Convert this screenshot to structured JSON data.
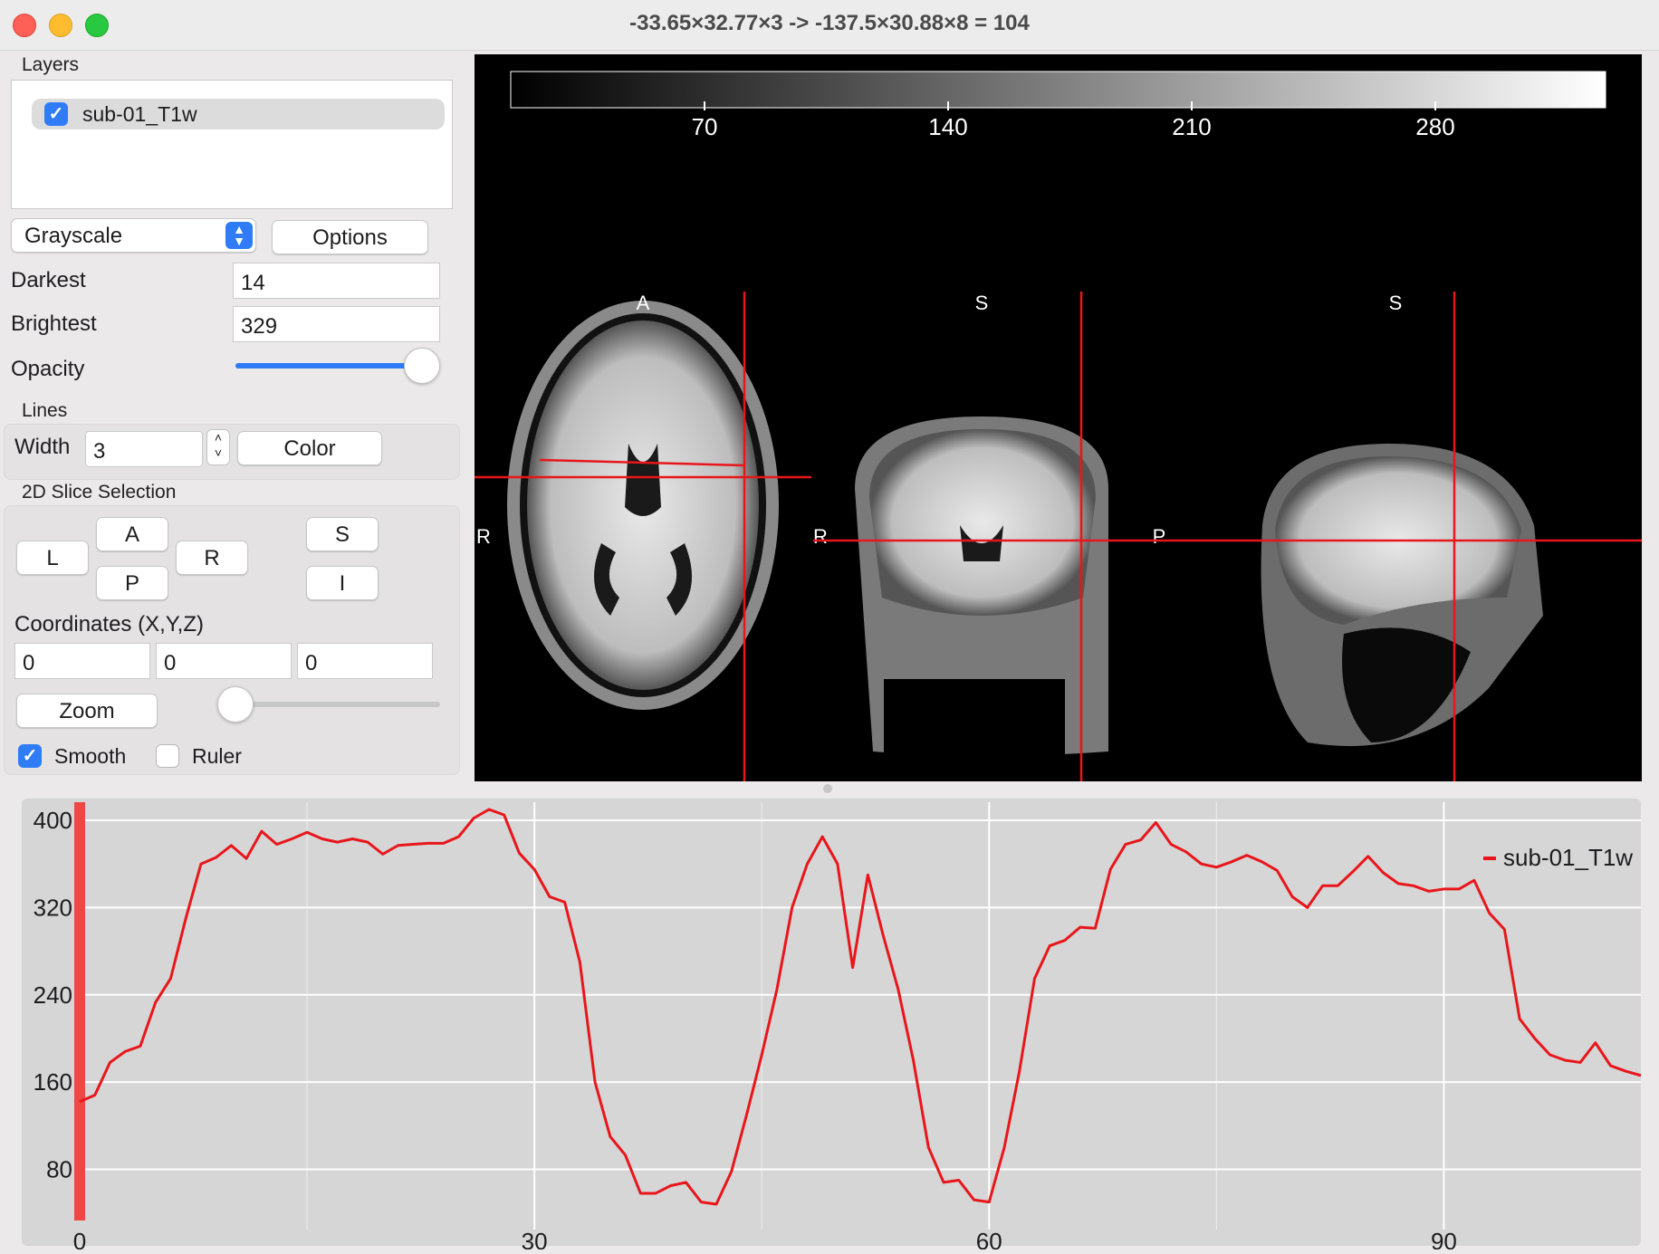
{
  "window": {
    "title": "-33.65×32.77×3 -> -137.5×30.88×8  = 104"
  },
  "layers": {
    "section_label": "Layers",
    "items": [
      {
        "label": "sub-01_T1w",
        "checked": true
      }
    ]
  },
  "display": {
    "colormap": "Grayscale",
    "options_label": "Options",
    "darkest_label": "Darkest",
    "darkest_value": "14",
    "brightest_label": "Brightest",
    "brightest_value": "329",
    "opacity_label": "Opacity",
    "opacity_fraction": 1.0
  },
  "lines": {
    "section_label": "Lines",
    "width_label": "Width",
    "width_value": "3",
    "color_label": "Color"
  },
  "slice_selection": {
    "section_label": "2D Slice Selection",
    "buttons": {
      "l": "L",
      "a": "A",
      "p": "P",
      "r": "R",
      "s": "S",
      "i": "I"
    },
    "coordinates_label": "Coordinates (X,Y,Z)",
    "x": "0",
    "y": "0",
    "z": "0",
    "zoom_label": "Zoom",
    "zoom_fraction": 0.0,
    "smooth_label": "Smooth",
    "smooth_checked": true,
    "ruler_label": "Ruler",
    "ruler_checked": false
  },
  "viewer": {
    "colorbar_ticks": [
      "70",
      "140",
      "210",
      "280"
    ],
    "axial": {
      "top": "A",
      "left": "R"
    },
    "coronal": {
      "top": "S",
      "left": "R"
    },
    "sagittal": {
      "top": "S",
      "left": "P"
    },
    "crosshair_color": "#e8161b"
  },
  "chart_data": {
    "type": "line",
    "title": "",
    "xlabel": "",
    "ylabel": "",
    "xlim": [
      0,
      103
    ],
    "ylim": [
      48,
      410
    ],
    "xticks": [
      0,
      30,
      60,
      90
    ],
    "yticks": [
      80,
      160,
      240,
      320,
      400
    ],
    "grid": true,
    "legend_position": "top-right",
    "series": [
      {
        "name": "sub-01_T1w",
        "color": "#e8161b",
        "x": [
          0,
          1,
          2,
          3,
          4,
          5,
          6,
          7,
          8,
          9,
          10,
          11,
          12,
          13,
          14,
          15,
          16,
          17,
          18,
          19,
          20,
          21,
          22,
          23,
          24,
          25,
          26,
          27,
          28,
          29,
          30,
          31,
          32,
          33,
          34,
          35,
          36,
          37,
          38,
          39,
          40,
          41,
          42,
          43,
          44,
          45,
          46,
          47,
          48,
          49,
          50,
          51,
          52,
          53,
          54,
          55,
          56,
          57,
          58,
          59,
          60,
          61,
          62,
          63,
          64,
          65,
          66,
          67,
          68,
          69,
          70,
          71,
          72,
          73,
          74,
          75,
          76,
          77,
          78,
          79,
          80,
          81,
          82,
          83,
          84,
          85,
          86,
          87,
          88,
          89,
          90,
          91,
          92,
          93,
          94,
          95,
          96,
          97,
          98,
          99,
          100,
          101,
          102,
          103
        ],
        "values": [
          142,
          148,
          178,
          188,
          193,
          233,
          255,
          310,
          360,
          366,
          377,
          365,
          390,
          378,
          383,
          389,
          383,
          380,
          383,
          380,
          369,
          377,
          378,
          379,
          379,
          385,
          402,
          410,
          405,
          370,
          355,
          330,
          325,
          270,
          160,
          110,
          93,
          58,
          58,
          65,
          68,
          50,
          48,
          78,
          130,
          185,
          245,
          320,
          360,
          385,
          360,
          265,
          350,
          295,
          245,
          180,
          100,
          68,
          70,
          52,
          50,
          100,
          170,
          255,
          285,
          290,
          302,
          301,
          355,
          378,
          382,
          398,
          378,
          371,
          360,
          357,
          362,
          368,
          362,
          354,
          330,
          320,
          340,
          340,
          353,
          367,
          352,
          342,
          340,
          335,
          337,
          337,
          345,
          315,
          300,
          218,
          200,
          185,
          180,
          178,
          196,
          175,
          170,
          166
        ]
      }
    ]
  }
}
